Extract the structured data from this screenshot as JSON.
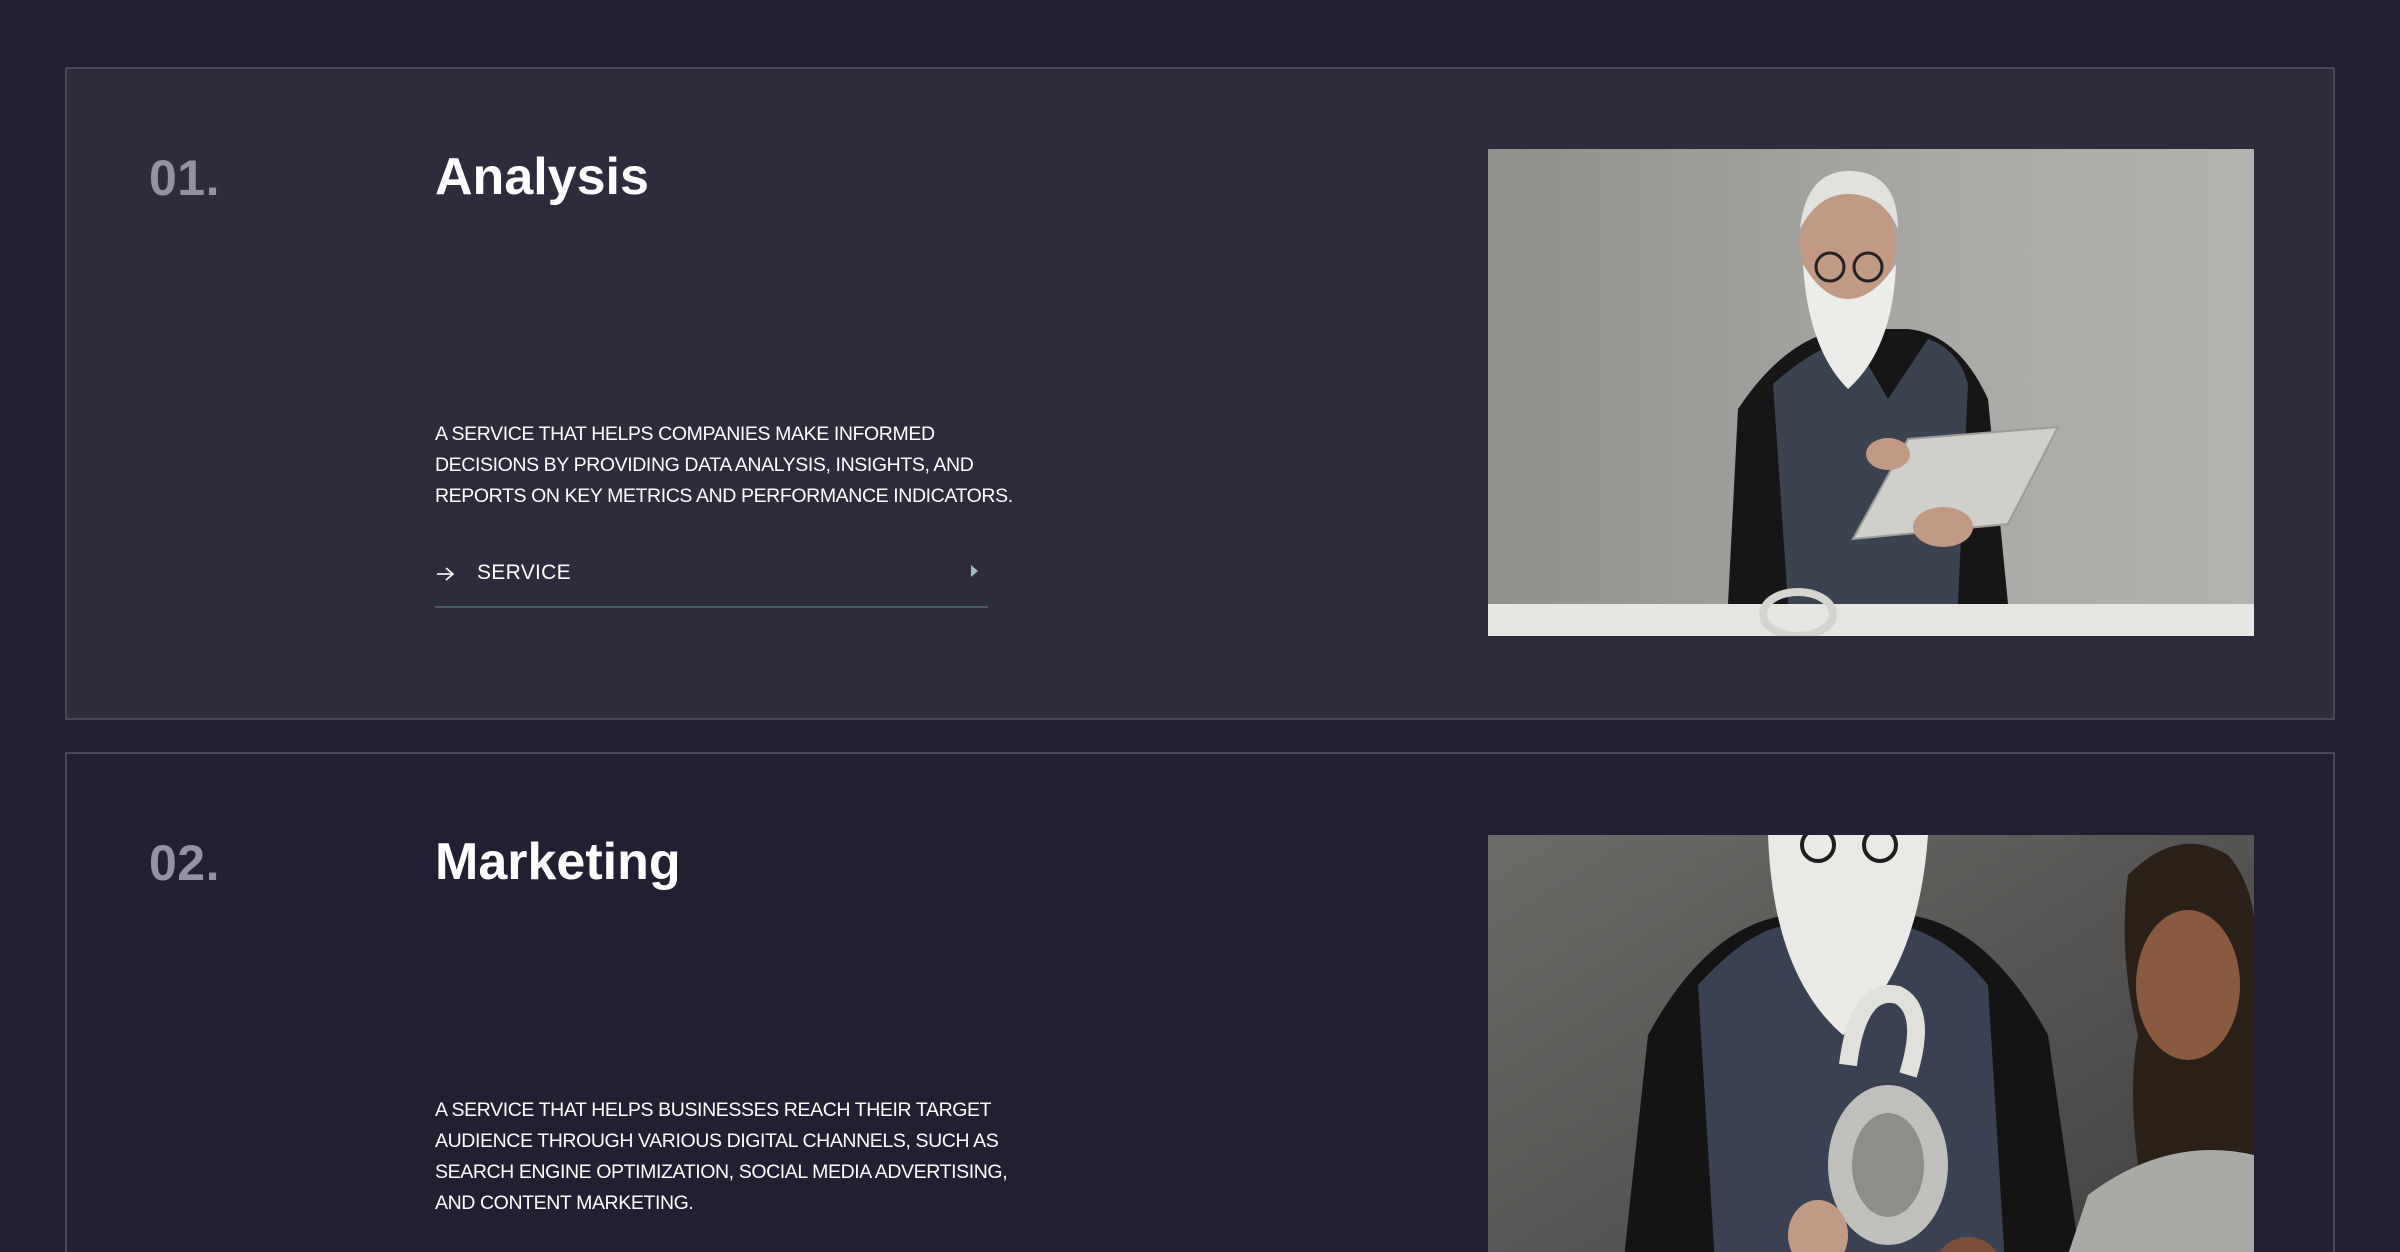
{
  "services": [
    {
      "number": "01.",
      "title": "Analysis",
      "description": "A service that helps companies make informed decisions by providing data analysis, insights, and reports on key metrics and performance indicators.",
      "link_label": "SERVICE",
      "image_alt": "Man with white beard writing on tablet"
    },
    {
      "number": "02.",
      "title": "Marketing",
      "description": "A service that helps businesses reach their target audience through various digital channels, such as search engine optimization, social media advertising, and content marketing.",
      "image_alt": "Man and woman examining headphones"
    }
  ],
  "colors": {
    "background": "#211e31",
    "card_highlight": "#2e2b3d",
    "border": "#4a4758",
    "number": "#9491a3",
    "link_underline": "#3f5f60"
  }
}
